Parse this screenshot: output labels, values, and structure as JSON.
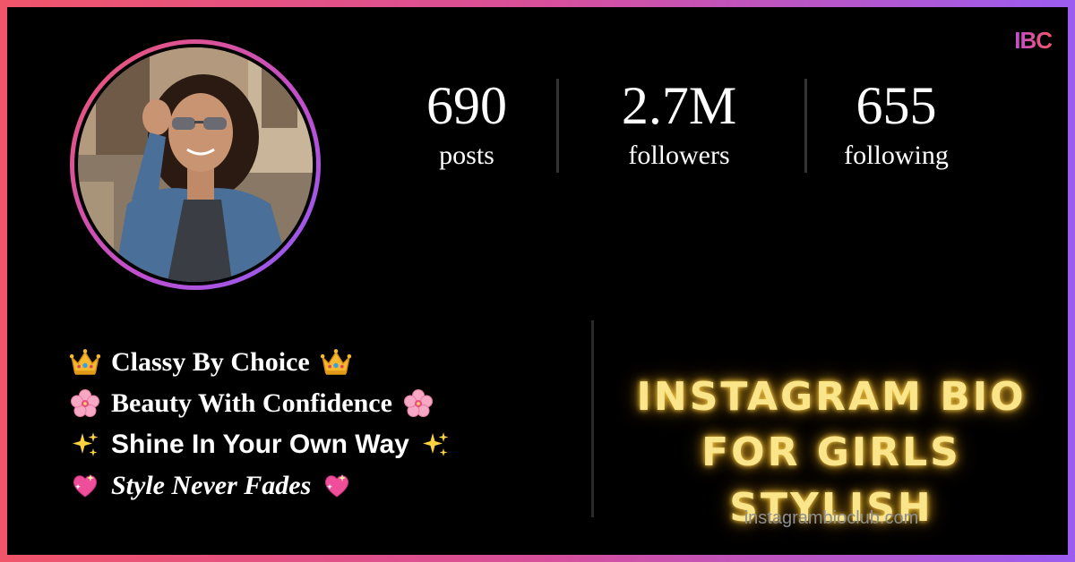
{
  "brand": {
    "logo_text": "IBC",
    "accent": "#f0556a",
    "accent2": "#9b5cf6"
  },
  "profile": {
    "stats": [
      {
        "value": "690",
        "label": "posts"
      },
      {
        "value": "2.7M",
        "label": "followers"
      },
      {
        "value": "655",
        "label": "following"
      }
    ]
  },
  "bio": {
    "lines": [
      {
        "text": "Classy By Choice",
        "emoji": "crown-icon"
      },
      {
        "text": "Beauty With Confidence",
        "emoji": "cherry-blossom-icon"
      },
      {
        "text": "Shine In Your Own Way",
        "emoji": "sparkles-icon"
      },
      {
        "text": "Style Never Fades",
        "emoji": "sparkling-heart-icon"
      }
    ]
  },
  "headline": {
    "line1": "INSTAGRAM BIO",
    "line2": "FOR GIRLS STYLISH",
    "color": "#fbe58a"
  },
  "site": {
    "url": "instagrambioclub.com"
  }
}
